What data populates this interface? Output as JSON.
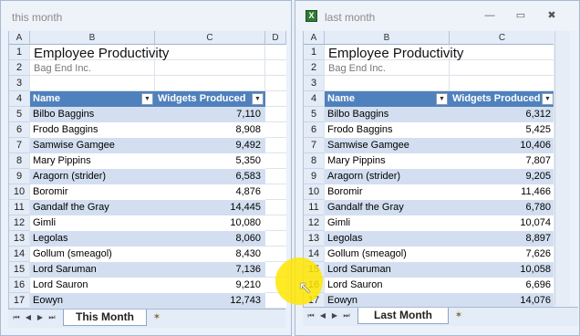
{
  "windows": {
    "this_month": {
      "title": "this month",
      "columns": [
        "A",
        "B",
        "C",
        "D"
      ],
      "rows": [
        "1",
        "2",
        "3",
        "4",
        "5",
        "6",
        "7",
        "8",
        "9",
        "10",
        "11",
        "12",
        "13",
        "14",
        "15",
        "16",
        "17"
      ],
      "report_title": "Employee Productivity",
      "company": "Bag End Inc.",
      "headers": {
        "name": "Name",
        "widgets": "Widgets Produced"
      },
      "employees": [
        {
          "name": "Bilbo Baggins",
          "widgets": "7,110"
        },
        {
          "name": "Frodo Baggins",
          "widgets": "8,908"
        },
        {
          "name": "Samwise Gamgee",
          "widgets": "9,492"
        },
        {
          "name": "Mary Pippins",
          "widgets": "5,350"
        },
        {
          "name": "Aragorn (strider)",
          "widgets": "6,583"
        },
        {
          "name": "Boromir",
          "widgets": "4,876"
        },
        {
          "name": "Gandalf the Gray",
          "widgets": "14,445"
        },
        {
          "name": "Gimli",
          "widgets": "10,080"
        },
        {
          "name": "Legolas",
          "widgets": "8,060"
        },
        {
          "name": "Gollum (smeagol)",
          "widgets": "8,430"
        },
        {
          "name": "Lord Saruman",
          "widgets": "7,136"
        },
        {
          "name": "Lord Sauron",
          "widgets": "9,210"
        },
        {
          "name": "Eowyn",
          "widgets": "12,743"
        }
      ],
      "sheet_tab": "This Month"
    },
    "last_month": {
      "title": "last month",
      "app_icon": "X",
      "controls": {
        "minimize": "—",
        "restore": "▭",
        "close": "✖"
      },
      "columns": [
        "A",
        "B",
        "C"
      ],
      "rows": [
        "1",
        "2",
        "3",
        "4",
        "5",
        "6",
        "7",
        "8",
        "9",
        "10",
        "11",
        "12",
        "13",
        "14",
        "15",
        "16",
        "17"
      ],
      "report_title": "Employee Productivity",
      "company": "Bag End Inc.",
      "headers": {
        "name": "Name",
        "widgets": "Widgets Produced"
      },
      "employees": [
        {
          "name": "Bilbo Baggins",
          "widgets": "6,312"
        },
        {
          "name": "Frodo Baggins",
          "widgets": "5,425"
        },
        {
          "name": "Samwise Gamgee",
          "widgets": "10,406"
        },
        {
          "name": "Mary Pippins",
          "widgets": "7,807"
        },
        {
          "name": "Aragorn (strider)",
          "widgets": "9,205"
        },
        {
          "name": "Boromir",
          "widgets": "11,466"
        },
        {
          "name": "Gandalf the Gray",
          "widgets": "6,780"
        },
        {
          "name": "Gimli",
          "widgets": "10,074"
        },
        {
          "name": "Legolas",
          "widgets": "8,897"
        },
        {
          "name": "Gollum (smeagol)",
          "widgets": "7,626"
        },
        {
          "name": "Lord Saruman",
          "widgets": "10,058"
        },
        {
          "name": "Lord Sauron",
          "widgets": "6,696"
        },
        {
          "name": "Eowyn",
          "widgets": "14,076"
        }
      ],
      "sheet_tab": "Last Month"
    }
  },
  "icons": {
    "nav_first": "⏮",
    "nav_prev": "◀",
    "nav_next": "▶",
    "nav_last": "⏭",
    "dropdown": "▼",
    "new_sheet": "✶"
  },
  "colors": {
    "table_header": "#4f81bd",
    "band": "#d3dff0",
    "highlight": "#ffe600"
  }
}
